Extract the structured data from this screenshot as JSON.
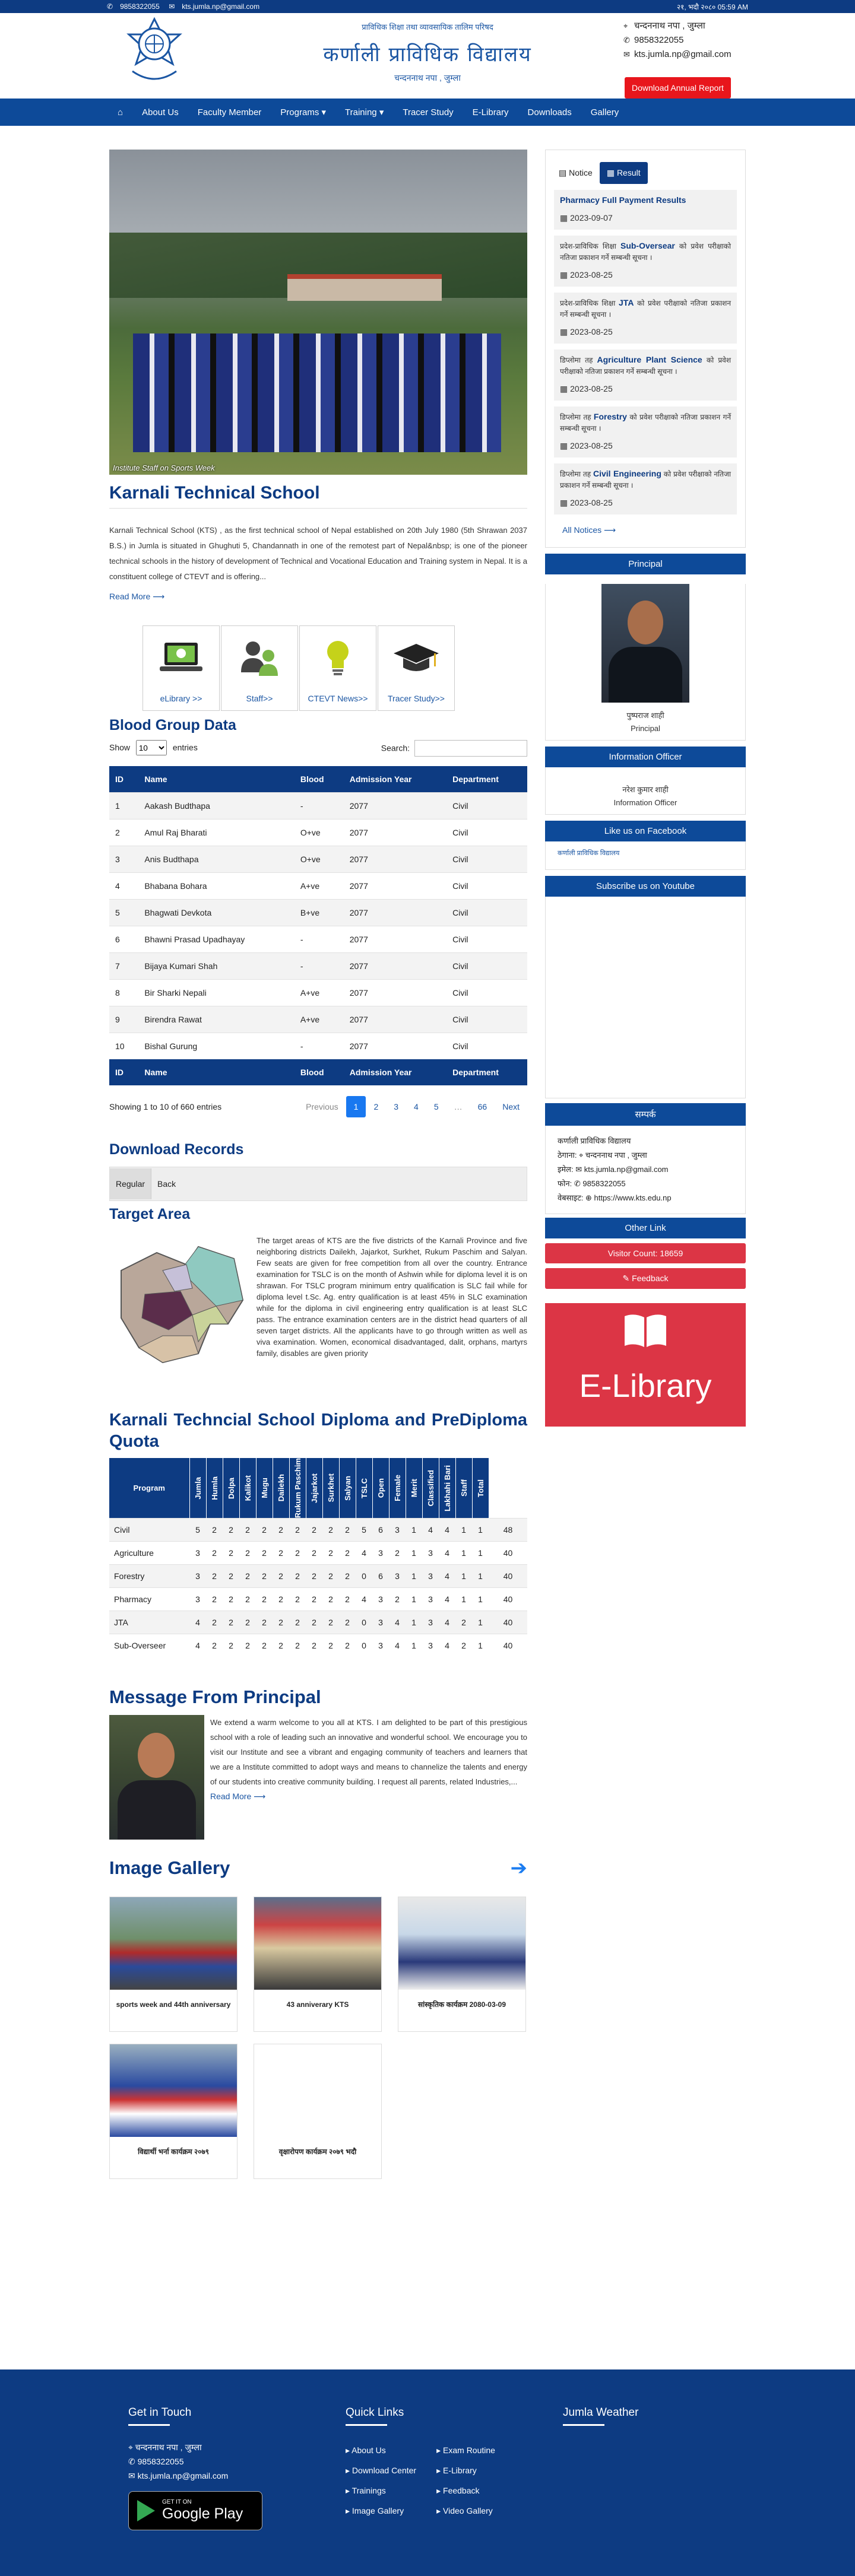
{
  "topbar": {
    "phone": "9858322055",
    "email": "kts.jumla.np@gmail.com",
    "datetime": "२१, भदौ २०८० 05:59 AM"
  },
  "header": {
    "tagline": "प्राविधिक शिक्षा तथा व्यावसायिक तालिम परिषद",
    "name_np": "कर्णाली प्राविधिक विद्यालय",
    "location_np": "चन्दननाथ नपा , जुम्ला",
    "contact_address": "चन्दननाथ नपा , जुम्ला",
    "contact_phone": "9858322055",
    "contact_email": "kts.jumla.np@gmail.com",
    "annual_report_button": "Download Annual Report"
  },
  "nav": [
    "About Us",
    "Faculty Member",
    "Programs ▾",
    "Training ▾",
    "Tracer Study",
    "E-Library",
    "Downloads",
    "Gallery"
  ],
  "slider": {
    "caption": "Institute Staff on Sports Week"
  },
  "intro": {
    "title": "Karnali Technical School",
    "text": "Karnali Technical School (KTS) , as the first technical school of Nepal established on 20th July 1980 (5th Shrawan 2037 B.S.) in Jumla is situated in Ghughuti 5, Chandannath in one of the remotest part of Nepal&nbsp; is one of the pioneer technical schools in the history of development of Technical and Vocational Education and Training system in Nepal. It is a constituent college of CTEVT and is offering...",
    "read_more": "Read More"
  },
  "quick_links": [
    "eLibrary >>",
    "Staff>>",
    "CTEVT News>>",
    "Tracer Study>>"
  ],
  "blood_group": {
    "title": "Blood Group Data",
    "show_label": "Show",
    "show_value": "10",
    "entries_label": "entries",
    "search_label": "Search:",
    "columns": [
      "ID",
      "Name",
      "Blood",
      "Admission Year",
      "Department"
    ],
    "rows": [
      [
        "1",
        "Aakash Budthapa",
        "-",
        "2077",
        "Civil"
      ],
      [
        "2",
        "Amul Raj Bharati",
        "O+ve",
        "2077",
        "Civil"
      ],
      [
        "3",
        "Anis Budthapa",
        "O+ve",
        "2077",
        "Civil"
      ],
      [
        "4",
        "Bhabana Bohara",
        "A+ve",
        "2077",
        "Civil"
      ],
      [
        "5",
        "Bhagwati Devkota",
        "B+ve",
        "2077",
        "Civil"
      ],
      [
        "6",
        "Bhawni Prasad Upadhayay",
        "-",
        "2077",
        "Civil"
      ],
      [
        "7",
        "Bijaya Kumari Shah",
        "-",
        "2077",
        "Civil"
      ],
      [
        "8",
        "Bir Sharki Nepali",
        "A+ve",
        "2077",
        "Civil"
      ],
      [
        "9",
        "Birendra Rawat",
        "A+ve",
        "2077",
        "Civil"
      ],
      [
        "10",
        "Bishal Gurung",
        "-",
        "2077",
        "Civil"
      ]
    ],
    "info": "Showing 1 to 10 of 660 entries",
    "pagination": [
      "Previous",
      "1",
      "2",
      "3",
      "4",
      "5",
      "…",
      "66",
      "Next"
    ]
  },
  "downloads": {
    "title": "Download Records",
    "tabs": [
      "Regular",
      "Back"
    ]
  },
  "target": {
    "title": "Target Area",
    "text": "The target areas of KTS are the five districts of the Karnali Province and five neighboring districts Dailekh, Jajarkot, Surkhet, Rukum Paschim and Salyan. Few seats are given for free competition from all over the country. Entrance examination for TSLC is on the month of Ashwin while for diploma level it is on shrawan. For TSLC program minimum entry qualification is SLC fail while for diploma level t.Sc. Ag. entry qualification is at least 45% in SLC examination while for the diploma in civil engineering entry qualification is at least SLC pass. The entrance examination centers are in the district head quarters of all seven target districts. All the applicants have to go through written as well as viva examination. Women, economical disadvantaged, dalit, orphans, martyrs family, disables are given priority"
  },
  "quota": {
    "title": "Karnali Techncial School Diploma and PreDiploma Quota",
    "columns": [
      "Program",
      "Jumla",
      "Humla",
      "Dolpa",
      "Kalikot",
      "Mugu",
      "Dailekh",
      "Rukum Paschim",
      "Jajarkot",
      "Surkhet",
      "Salyan",
      "TSLC",
      "Open",
      "Female",
      "Merit",
      "Classified",
      "Lakhahi Bari",
      "Staff",
      "Total"
    ],
    "rows": [
      [
        "Civil",
        "5",
        "2",
        "2",
        "2",
        "2",
        "2",
        "2",
        "2",
        "2",
        "2",
        "5",
        "6",
        "3",
        "1",
        "4",
        "4",
        "1",
        "1",
        "48"
      ],
      [
        "Agriculture",
        "3",
        "2",
        "2",
        "2",
        "2",
        "2",
        "2",
        "2",
        "2",
        "2",
        "4",
        "3",
        "2",
        "1",
        "3",
        "4",
        "1",
        "1",
        "40"
      ],
      [
        "Forestry",
        "3",
        "2",
        "2",
        "2",
        "2",
        "2",
        "2",
        "2",
        "2",
        "2",
        "0",
        "6",
        "3",
        "1",
        "3",
        "4",
        "1",
        "1",
        "40"
      ],
      [
        "Pharmacy",
        "3",
        "2",
        "2",
        "2",
        "2",
        "2",
        "2",
        "2",
        "2",
        "2",
        "4",
        "3",
        "2",
        "1",
        "3",
        "4",
        "1",
        "1",
        "40"
      ],
      [
        "JTA",
        "4",
        "2",
        "2",
        "2",
        "2",
        "2",
        "2",
        "2",
        "2",
        "2",
        "0",
        "3",
        "4",
        "1",
        "3",
        "4",
        "2",
        "1",
        "40"
      ],
      [
        "Sub-Overseer",
        "4",
        "2",
        "2",
        "2",
        "2",
        "2",
        "2",
        "2",
        "2",
        "2",
        "0",
        "3",
        "4",
        "1",
        "3",
        "4",
        "2",
        "1",
        "40"
      ]
    ]
  },
  "principal_message": {
    "title": "Message From Principal",
    "text": "We extend a warm welcome to you all at KTS. I am delighted to be part of this prestigious school with a role of leading such an innovative and wonderful school. We encourage you to visit our Institute and see a vibrant and engaging community of teachers and learners that we are a Institute committed to adopt ways and means to channelize the talents and energy of our students into creative community building. I request all parents, related Industries,...",
    "read_more": "Read More"
  },
  "gallery": {
    "title": "Image Gallery",
    "items": [
      "sports week and 44th anniversary",
      "43 anniverary KTS",
      "सांस्कृतिक कार्यक्रम 2080-03-09",
      "विद्यार्थी भर्ना कार्यक्रम २०७९",
      "वृक्षारोपण कार्यक्रम २०७९ भदौ"
    ]
  },
  "notices": {
    "tabs": [
      "Notice",
      "Result"
    ],
    "items": [
      {
        "text_html": "<b>Pharmacy Full Payment Results</b>",
        "date": "2023-09-07"
      },
      {
        "text_html": "प्रदेश-प्राविधिक शिक्षा <b>Sub-Oversear</b> को प्रवेश परीक्षाको नतिजा प्रकाशन गर्ने सम्बन्धी सूचना ।",
        "date": "2023-08-25"
      },
      {
        "text_html": "प्रदेश-प्राविधिक शिक्षा <b>JTA</b> को प्रवेश परीक्षाको नतिजा प्रकाशन गर्ने सम्बन्धी सूचना ।",
        "date": "2023-08-25"
      },
      {
        "text_html": "डिप्लोमा तह <b>Agriculture Plant Science</b> को प्रवेश परीक्षाको नतिजा प्रकाशन गर्ने सम्बन्धी सूचना ।",
        "date": "2023-08-25"
      },
      {
        "text_html": "डिप्लोमा तह <b>Forestry</b> को प्रवेश परीक्षाको नतिजा प्रकाशन गर्ने सम्बन्धी सूचना ।",
        "date": "2023-08-25"
      },
      {
        "text_html": "डिप्लोमा तह <b>Civil Engineering</b> को प्रवेश परीक्षाको नतिजा प्रकाशन गर्ने सम्बन्धी सूचना ।",
        "date": "2023-08-25"
      }
    ],
    "all_label": "All Notices"
  },
  "principal": {
    "heading": "Principal",
    "name": "पुष्पराज शाही",
    "role": "Principal"
  },
  "info_officer": {
    "heading": "Information Officer",
    "name": "नरेश कुमार शाही",
    "role": "Information Officer"
  },
  "facebook": {
    "heading": "Like us on Facebook",
    "link": "कर्णाली प्राविधिक विद्यालय"
  },
  "youtube": {
    "heading": "Subscribe us on Youtube"
  },
  "contact": {
    "heading": "सम्पर्क",
    "org": "कर्णाली प्राविधिक विद्यालय",
    "address_label": "ठेगाना:",
    "address": "चन्दननाथ नपा , जुम्ला",
    "email_label": "इमेल:",
    "email": "kts.jumla.np@gmail.com",
    "phone_label": "फोन:",
    "phone": "9858322055",
    "web_label": "वेबसाइट:",
    "web": "https://www.kts.edu.np"
  },
  "other_link": {
    "heading": "Other Link",
    "visitor": "Visitor Count: 18659",
    "feedback": "Feedback"
  },
  "elibrary_banner": "E-Library",
  "footer": {
    "get_in_touch": "Get in Touch",
    "address": "चन्दननाथ नपा , जुम्ला",
    "phone": "9858322055",
    "email": "kts.jumla.np@gmail.com",
    "quick_links_title": "Quick Links",
    "links_col1": [
      "About Us",
      "Download Center",
      "Trainings",
      "Image Gallery"
    ],
    "links_col2": [
      "Exam Routine",
      "E-Library",
      "Feedback",
      "Video Gallery"
    ],
    "weather_title": "Jumla Weather",
    "gplay_small": "GET IT ON",
    "gplay_big": "Google Play"
  },
  "colors": {
    "primary": "#0d3b82",
    "nav": "#0d4a99",
    "accent_red": "#dc3545",
    "link": "#1b56a3"
  }
}
